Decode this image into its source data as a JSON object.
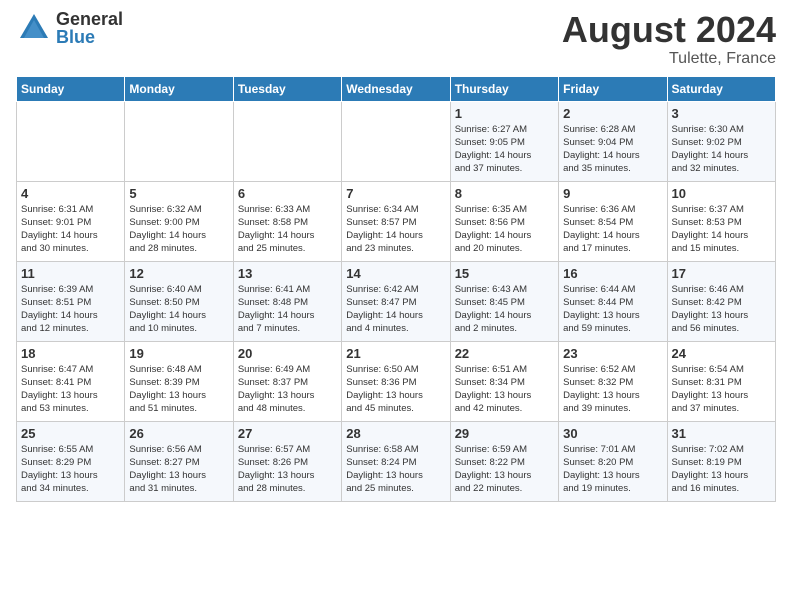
{
  "logo": {
    "general": "General",
    "blue": "Blue"
  },
  "title": "August 2024",
  "subtitle": "Tulette, France",
  "days_of_week": [
    "Sunday",
    "Monday",
    "Tuesday",
    "Wednesday",
    "Thursday",
    "Friday",
    "Saturday"
  ],
  "weeks": [
    [
      {
        "day": "",
        "detail": ""
      },
      {
        "day": "",
        "detail": ""
      },
      {
        "day": "",
        "detail": ""
      },
      {
        "day": "",
        "detail": ""
      },
      {
        "day": "1",
        "detail": "Sunrise: 6:27 AM\nSunset: 9:05 PM\nDaylight: 14 hours\nand 37 minutes."
      },
      {
        "day": "2",
        "detail": "Sunrise: 6:28 AM\nSunset: 9:04 PM\nDaylight: 14 hours\nand 35 minutes."
      },
      {
        "day": "3",
        "detail": "Sunrise: 6:30 AM\nSunset: 9:02 PM\nDaylight: 14 hours\nand 32 minutes."
      }
    ],
    [
      {
        "day": "4",
        "detail": "Sunrise: 6:31 AM\nSunset: 9:01 PM\nDaylight: 14 hours\nand 30 minutes."
      },
      {
        "day": "5",
        "detail": "Sunrise: 6:32 AM\nSunset: 9:00 PM\nDaylight: 14 hours\nand 28 minutes."
      },
      {
        "day": "6",
        "detail": "Sunrise: 6:33 AM\nSunset: 8:58 PM\nDaylight: 14 hours\nand 25 minutes."
      },
      {
        "day": "7",
        "detail": "Sunrise: 6:34 AM\nSunset: 8:57 PM\nDaylight: 14 hours\nand 23 minutes."
      },
      {
        "day": "8",
        "detail": "Sunrise: 6:35 AM\nSunset: 8:56 PM\nDaylight: 14 hours\nand 20 minutes."
      },
      {
        "day": "9",
        "detail": "Sunrise: 6:36 AM\nSunset: 8:54 PM\nDaylight: 14 hours\nand 17 minutes."
      },
      {
        "day": "10",
        "detail": "Sunrise: 6:37 AM\nSunset: 8:53 PM\nDaylight: 14 hours\nand 15 minutes."
      }
    ],
    [
      {
        "day": "11",
        "detail": "Sunrise: 6:39 AM\nSunset: 8:51 PM\nDaylight: 14 hours\nand 12 minutes."
      },
      {
        "day": "12",
        "detail": "Sunrise: 6:40 AM\nSunset: 8:50 PM\nDaylight: 14 hours\nand 10 minutes."
      },
      {
        "day": "13",
        "detail": "Sunrise: 6:41 AM\nSunset: 8:48 PM\nDaylight: 14 hours\nand 7 minutes."
      },
      {
        "day": "14",
        "detail": "Sunrise: 6:42 AM\nSunset: 8:47 PM\nDaylight: 14 hours\nand 4 minutes."
      },
      {
        "day": "15",
        "detail": "Sunrise: 6:43 AM\nSunset: 8:45 PM\nDaylight: 14 hours\nand 2 minutes."
      },
      {
        "day": "16",
        "detail": "Sunrise: 6:44 AM\nSunset: 8:44 PM\nDaylight: 13 hours\nand 59 minutes."
      },
      {
        "day": "17",
        "detail": "Sunrise: 6:46 AM\nSunset: 8:42 PM\nDaylight: 13 hours\nand 56 minutes."
      }
    ],
    [
      {
        "day": "18",
        "detail": "Sunrise: 6:47 AM\nSunset: 8:41 PM\nDaylight: 13 hours\nand 53 minutes."
      },
      {
        "day": "19",
        "detail": "Sunrise: 6:48 AM\nSunset: 8:39 PM\nDaylight: 13 hours\nand 51 minutes."
      },
      {
        "day": "20",
        "detail": "Sunrise: 6:49 AM\nSunset: 8:37 PM\nDaylight: 13 hours\nand 48 minutes."
      },
      {
        "day": "21",
        "detail": "Sunrise: 6:50 AM\nSunset: 8:36 PM\nDaylight: 13 hours\nand 45 minutes."
      },
      {
        "day": "22",
        "detail": "Sunrise: 6:51 AM\nSunset: 8:34 PM\nDaylight: 13 hours\nand 42 minutes."
      },
      {
        "day": "23",
        "detail": "Sunrise: 6:52 AM\nSunset: 8:32 PM\nDaylight: 13 hours\nand 39 minutes."
      },
      {
        "day": "24",
        "detail": "Sunrise: 6:54 AM\nSunset: 8:31 PM\nDaylight: 13 hours\nand 37 minutes."
      }
    ],
    [
      {
        "day": "25",
        "detail": "Sunrise: 6:55 AM\nSunset: 8:29 PM\nDaylight: 13 hours\nand 34 minutes."
      },
      {
        "day": "26",
        "detail": "Sunrise: 6:56 AM\nSunset: 8:27 PM\nDaylight: 13 hours\nand 31 minutes."
      },
      {
        "day": "27",
        "detail": "Sunrise: 6:57 AM\nSunset: 8:26 PM\nDaylight: 13 hours\nand 28 minutes."
      },
      {
        "day": "28",
        "detail": "Sunrise: 6:58 AM\nSunset: 8:24 PM\nDaylight: 13 hours\nand 25 minutes."
      },
      {
        "day": "29",
        "detail": "Sunrise: 6:59 AM\nSunset: 8:22 PM\nDaylight: 13 hours\nand 22 minutes."
      },
      {
        "day": "30",
        "detail": "Sunrise: 7:01 AM\nSunset: 8:20 PM\nDaylight: 13 hours\nand 19 minutes."
      },
      {
        "day": "31",
        "detail": "Sunrise: 7:02 AM\nSunset: 8:19 PM\nDaylight: 13 hours\nand 16 minutes."
      }
    ]
  ]
}
